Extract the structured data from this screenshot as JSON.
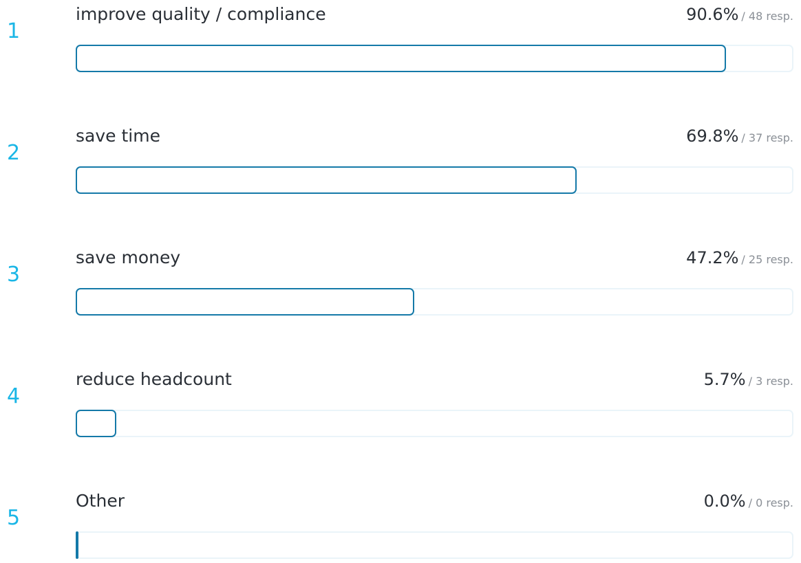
{
  "chart_data": {
    "type": "bar",
    "orientation": "horizontal",
    "categories": [
      "improve quality / compliance",
      "save time",
      "save money",
      "reduce headcount",
      "Other"
    ],
    "ranks": [
      "1",
      "2",
      "3",
      "4",
      "5"
    ],
    "values": [
      90.6,
      69.8,
      47.2,
      5.7,
      0.0
    ],
    "value_labels": [
      "90.6%",
      "69.8%",
      "47.2%",
      "5.7%",
      "0.0%"
    ],
    "responses": [
      48,
      37,
      25,
      3,
      0
    ],
    "response_labels": [
      "/ 48 resp.",
      "/ 37 resp.",
      "/ 25 resp.",
      "/ 3 resp.",
      "/ 0 resp."
    ],
    "xlim": [
      0,
      100
    ],
    "grid": false,
    "colors": {
      "rank": "#1ab6e6",
      "bar_outline": "#1479a8",
      "track_outline": "#eaf4f9",
      "label": "#2a2f36",
      "muted": "#8a8f96"
    }
  }
}
